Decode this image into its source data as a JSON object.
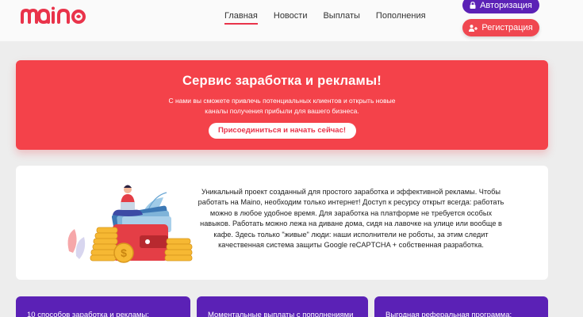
{
  "header": {
    "logo_text": "MAINO",
    "nav": [
      {
        "label": "Главная",
        "active": true
      },
      {
        "label": "Новости",
        "active": false
      },
      {
        "label": "Выплаты",
        "active": false
      },
      {
        "label": "Пополнения",
        "active": false
      }
    ],
    "login_label": "Авторизация",
    "register_label": "Регистрация"
  },
  "hero": {
    "title": "Сервис заработка и рекламы!",
    "description": "С нами вы сможете привлечь потенциальных клиентов и открыть новые каналы получения прибыли для вашего бизнеса.",
    "cta_label": "Присоединиться и начать сейчас!"
  },
  "about": {
    "text": "Уникальный проект созданный для простого заработка и эффективной рекламы. Чтобы работать на Maino, необходим только интернет! Доступ к ресурсу открыт всегда: работать можно в любое удобное время. Для заработка на платформе не требуется особых навыков. Работать можно лежа на диване дома, сидя на лавочке на улице или вообще в кафе. Здесь только \"живые\" люди: наши исполнители не роботы, за этим следит качественная система защиты Google reCAPTCHA + собственная разработка."
  },
  "cards": [
    {
      "label": "10 способов заработка и рекламы:"
    },
    {
      "label": "Моментальные выплаты с пополнениями"
    },
    {
      "label": "Выгодная реферальная программа:"
    }
  ],
  "colors": {
    "brand_red": "#f4424a",
    "brand_purple": "#5b21b6",
    "nav_underline": "#e9334a"
  },
  "icons": [
    "lock-icon",
    "user-plus-icon"
  ]
}
